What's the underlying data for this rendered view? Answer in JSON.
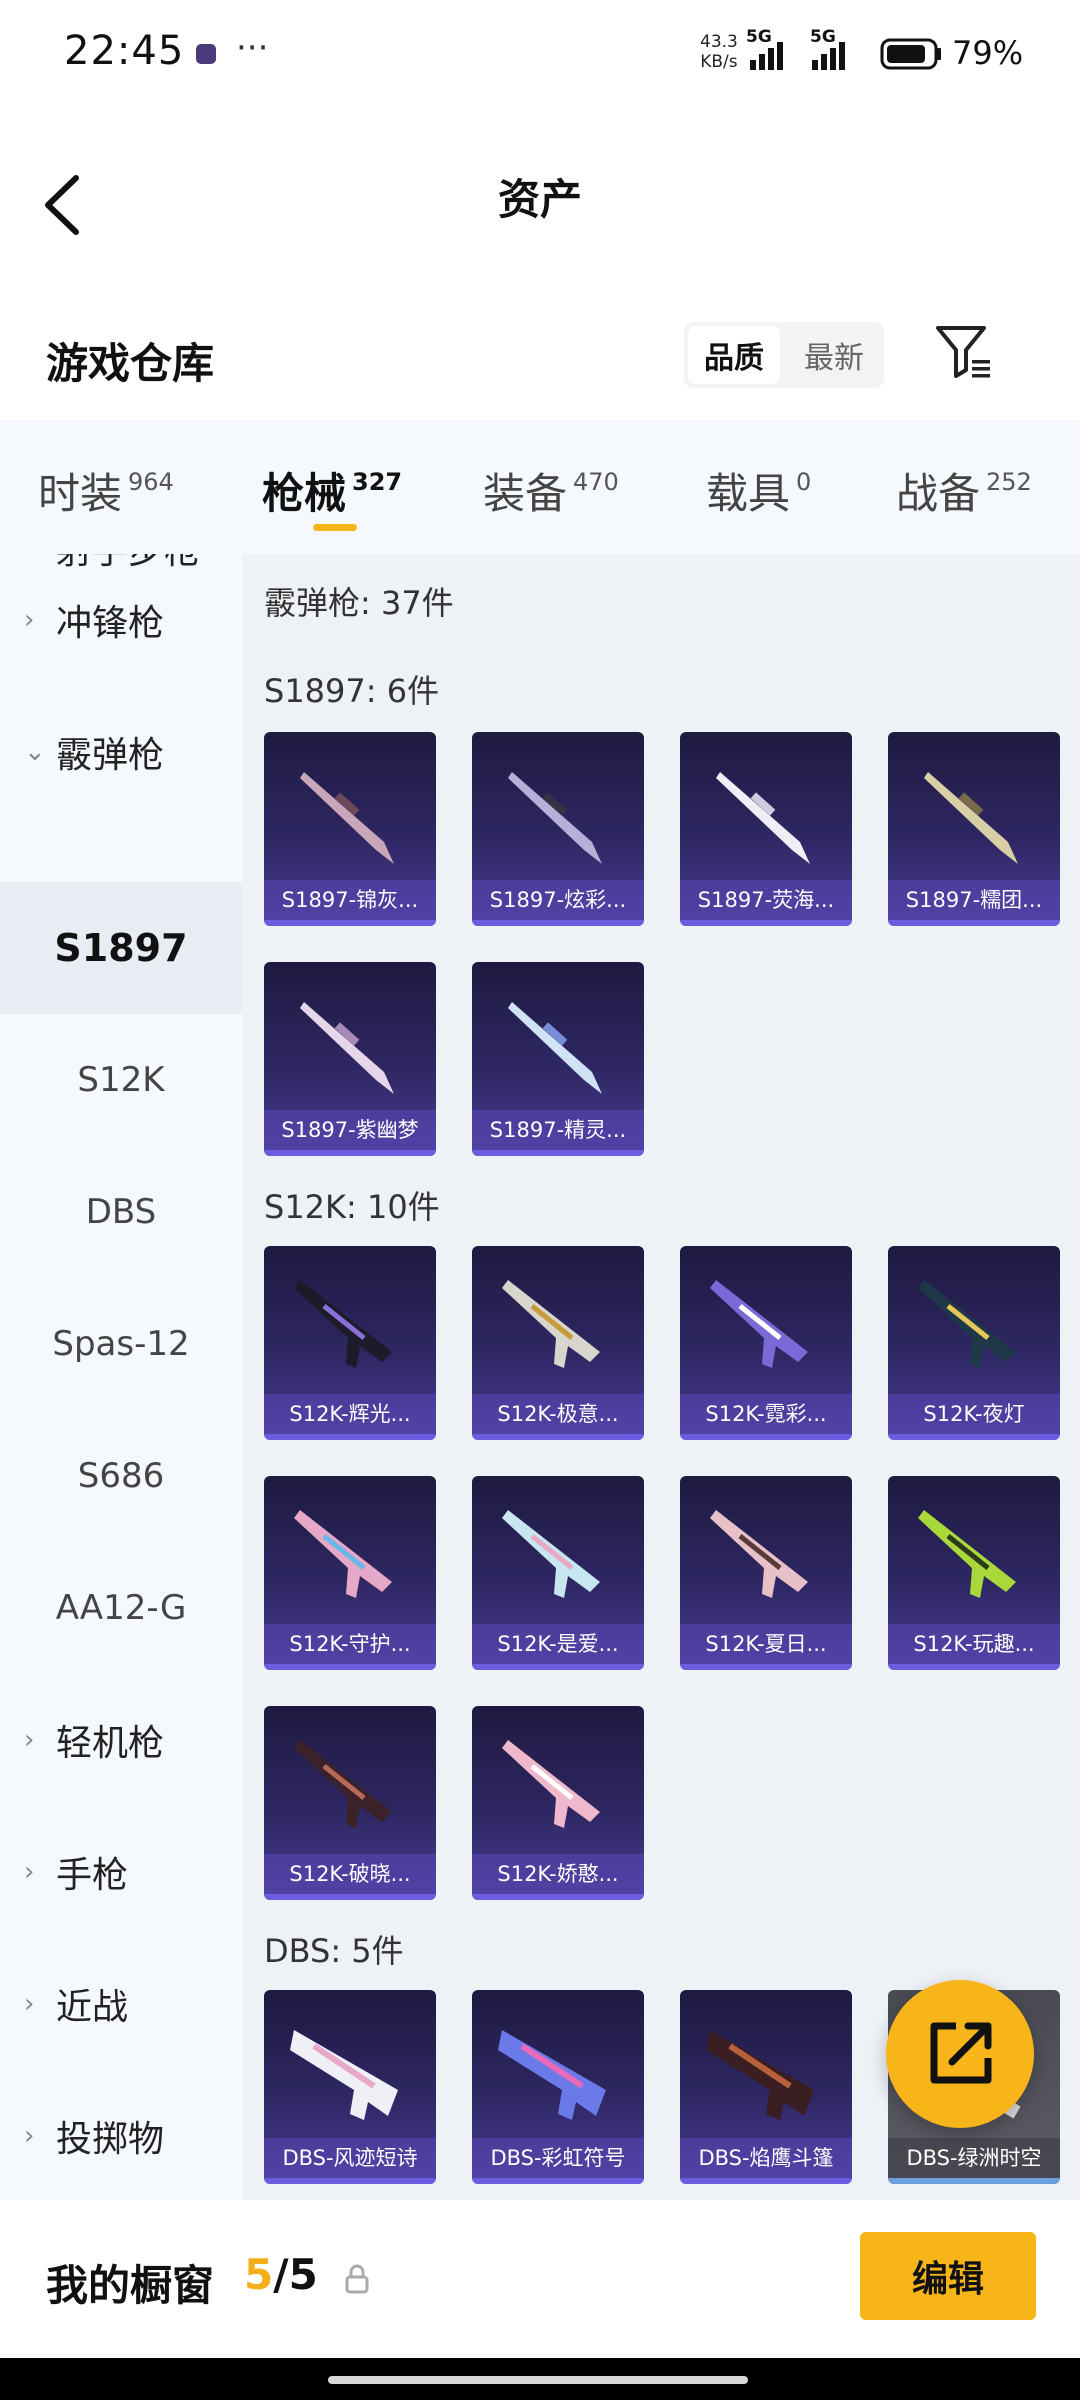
{
  "status_bar": {
    "time": "22:45",
    "more": "···",
    "net_speed_value": "43.3",
    "net_speed_unit": "KB/s",
    "net1": "5G",
    "net2": "5G",
    "battery": "79%"
  },
  "header": {
    "title": "资产"
  },
  "warehouse": {
    "title": "游戏仓库",
    "sort_options": [
      "品质",
      "最新"
    ],
    "sort_selected": "品质"
  },
  "tabs": [
    {
      "label": "时装",
      "count": "964"
    },
    {
      "label": "枪械",
      "count": "327"
    },
    {
      "label": "装备",
      "count": "470"
    },
    {
      "label": "载具",
      "count": "0"
    },
    {
      "label": "战备",
      "count": "252"
    }
  ],
  "active_tab": "枪械",
  "sidebar": {
    "partial_top": "射手步枪",
    "items": [
      {
        "label": "冲锋枪",
        "type": "category"
      },
      {
        "label": "霰弹枪",
        "type": "category",
        "expanded": true
      },
      {
        "label": "S1897",
        "type": "sub",
        "active": true
      },
      {
        "label": "S12K",
        "type": "sub"
      },
      {
        "label": "DBS",
        "type": "sub"
      },
      {
        "label": "Spas-12",
        "type": "sub"
      },
      {
        "label": "S686",
        "type": "sub"
      },
      {
        "label": "AA12-G",
        "type": "sub"
      },
      {
        "label": "轻机枪",
        "type": "category"
      },
      {
        "label": "手枪",
        "type": "category"
      },
      {
        "label": "近战",
        "type": "category"
      },
      {
        "label": "投掷物",
        "type": "category"
      }
    ]
  },
  "content": {
    "category_header": "霰弹枪: 37件",
    "groups": [
      {
        "header": "S1897: 6件",
        "items": [
          "S1897-锦灰...",
          "S1897-炫彩...",
          "S1897-荧海...",
          "S1897-糯团...",
          "S1897-紫幽梦",
          "S1897-精灵..."
        ]
      },
      {
        "header": "S12K: 10件",
        "items": [
          "S12K-辉光...",
          "S12K-极意...",
          "S12K-霓彩...",
          "S12K-夜灯",
          "S12K-守护...",
          "S12K-是爱...",
          "S12K-夏日...",
          "S12K-玩趣...",
          "S12K-破晓...",
          "S12K-娇憨..."
        ]
      },
      {
        "header": "DBS: 5件",
        "items": [
          "DBS-风迹短诗",
          "DBS-彩虹符号",
          "DBS-焰鹰斗篷",
          "DBS-绿洲时空"
        ]
      }
    ]
  },
  "bottom_bar": {
    "title": "我的橱窗",
    "used": "5",
    "sep": "/",
    "total": "5",
    "edit_label": "编辑"
  },
  "colors": {
    "accent": "#f7b51a",
    "card_bg_top": "#1e1a40",
    "card_bg_bottom": "#4a3e96",
    "sidebar_bg": "#f5f8fd",
    "content_bg": "#eef1f6"
  },
  "icons": {
    "back": "chevron-left-icon",
    "filter": "filter-icon",
    "share": "share-external-icon",
    "lock": "lock-icon"
  }
}
